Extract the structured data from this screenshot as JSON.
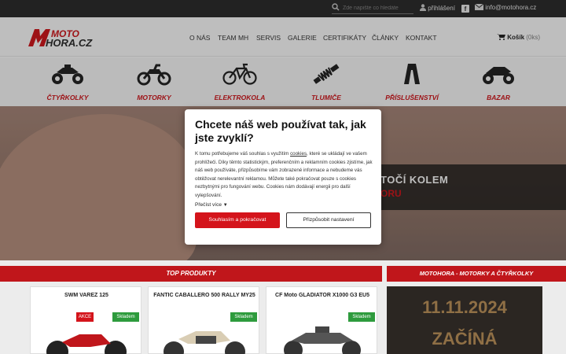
{
  "topbar": {
    "search_placeholder": "Zde napište co hledáte",
    "login": "přihlášení",
    "email": "info@motohora.cz"
  },
  "logo": {
    "line1": "MOTO",
    "line2": "HORA.CZ"
  },
  "nav": [
    "O NÁS",
    "TEAM MH",
    "SERVIS",
    "GALERIE",
    "CERTIFIKÁTY",
    "ČLÁNKY",
    "KONTAKT"
  ],
  "cart": {
    "label": "Košík",
    "count": "(0ks)"
  },
  "categories": [
    "ČTYŘKOLKY",
    "MOTORKY",
    "ELEKTROKOLA",
    "TLUMIČE",
    "PŘÍSLUŠENSTVÍ",
    "BAZAR"
  ],
  "hero": {
    "line1": "TOČÍ KOLEM",
    "line2": "ORU"
  },
  "cookie": {
    "title": "Chcete náš web používat tak, jak jste zvyklí?",
    "text_a": "K tomu potřebujeme váš souhlas s využitím ",
    "link": "cookies",
    "text_b": ", které se ukládají ve vašem prohlížeči. Díky těmto statistickým, preferenčním a reklamním cookies zjistíme, jak náš web používáte, přizpůsobíme vám zobrazené informace a nebudeme vás obtěžovat nerelevantní reklamou. Můžete také pokračovat pouze s cookies nezbytnými pro fungování webu. Cookies nám dodávají energii pro další vylepšování.",
    "read_more": "Přečíst více",
    "accept": "Souhlasím a pokračovat",
    "customize": "Přizpůsobit nastavení"
  },
  "sections": {
    "top": "TOP PRODUKTY",
    "right": "MOTOHORA - MOTORKY A ČTYŘKOLKY"
  },
  "products": [
    {
      "name": "SWM VAREZ 125",
      "badges": [
        "AKCE",
        "Skladem"
      ]
    },
    {
      "name": "FANTIC CABALLERO 500 RALLY MY25",
      "badges": [
        "Skladem"
      ]
    },
    {
      "name": "CF Moto GLADIATOR X1000 G3 EU5",
      "badges": [
        "Skladem"
      ]
    }
  ],
  "promo": {
    "line1": "11.11.2024",
    "line2": "ZAČÍNÁ"
  },
  "colors": {
    "brand_red": "#c0161b",
    "stock_green": "#2e9b3d",
    "dark": "#2a2a2a"
  }
}
